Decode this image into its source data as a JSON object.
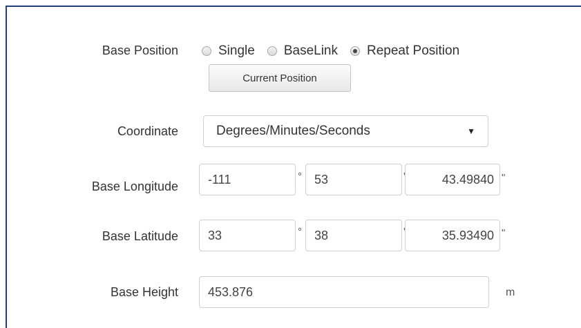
{
  "base_position": {
    "label": "Base Position",
    "options": [
      {
        "label": "Single",
        "selected": false
      },
      {
        "label": "BaseLink",
        "selected": false
      },
      {
        "label": "Repeat Position",
        "selected": true
      }
    ],
    "current_position_button": "Current Position"
  },
  "coordinate": {
    "label": "Coordinate",
    "selected": "Degrees/Minutes/Seconds"
  },
  "longitude": {
    "label": "Base Longitude",
    "degrees": "-111",
    "minutes": "53",
    "seconds": "43.49840",
    "deg_symbol": "°",
    "min_symbol": "'",
    "sec_symbol": "\""
  },
  "latitude": {
    "label": "Base Latitude",
    "degrees": "33",
    "minutes": "38",
    "seconds": "35.93490",
    "deg_symbol": "°",
    "min_symbol": "'",
    "sec_symbol": "\""
  },
  "height": {
    "label": "Base Height",
    "value": "453.876",
    "unit": "m"
  }
}
